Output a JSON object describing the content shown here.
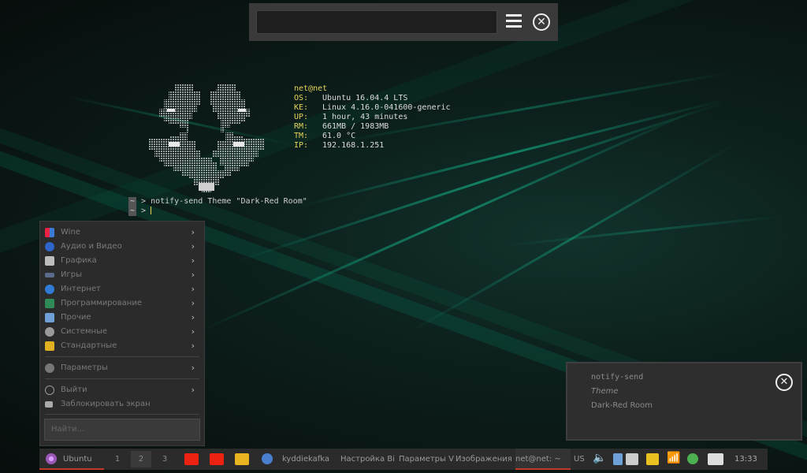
{
  "top_bar": {
    "search_value": "",
    "menu_icon": "hamburger-menu-icon",
    "close_icon": "close-circle-icon"
  },
  "neofetch": {
    "host": "net@net",
    "rows": [
      {
        "key": "OS:",
        "value": "Ubuntu 16.04.4 LTS"
      },
      {
        "key": "KE:",
        "value": "Linux 4.16.0-041600-generic"
      },
      {
        "key": "UP:",
        "value": "1 hour, 43 minutes"
      },
      {
        "key": "RM:",
        "value": "661MB / 1983MB"
      },
      {
        "key": "TM:",
        "value": "61.0 °C"
      },
      {
        "key": "IP:",
        "value": "192.168.1.251"
      }
    ]
  },
  "terminal": {
    "tag": "~",
    "prompt": ">",
    "command": "notify-send Theme \"Dark-Red Room\""
  },
  "app_menu": {
    "items": [
      {
        "label": "Wine",
        "icon": "wine-icon",
        "color": "#3b7bd6"
      },
      {
        "label": "Аудио и Видео",
        "icon": "audio-video-icon",
        "color": "#2f64c8"
      },
      {
        "label": "Графика",
        "icon": "graphics-icon",
        "color": "#bdbdbd"
      },
      {
        "label": "Игры",
        "icon": "games-icon",
        "color": "#5a6b8c"
      },
      {
        "label": "Интернет",
        "icon": "internet-icon",
        "color": "#2f7bd6"
      },
      {
        "label": "Программирование",
        "icon": "programming-icon",
        "color": "#2e8b57"
      },
      {
        "label": "Прочие",
        "icon": "other-icon",
        "color": "#6fa0d8"
      },
      {
        "label": "Системные",
        "icon": "system-icon",
        "color": "#9a9a9a"
      },
      {
        "label": "Стандартные",
        "icon": "accessories-icon",
        "color": "#e0b020"
      }
    ],
    "settings": {
      "label": "Параметры",
      "icon": "settings-icon"
    },
    "logout": {
      "label": "Выйти",
      "icon": "power-icon"
    },
    "lock": {
      "label": "Заблокировать экран",
      "icon": "lock-screen-icon"
    },
    "search_placeholder": "Найти..."
  },
  "notification": {
    "title": "notify-send",
    "summary": "Theme",
    "body": "Dark-Red Room"
  },
  "taskbar": {
    "start_label": "Ubuntu",
    "workspaces": [
      "1",
      "2",
      "3"
    ],
    "tasks": [
      "kyddiekafka",
      "Настройка Ві",
      "Параметры V",
      "Изображения",
      "net@net: ~"
    ],
    "keyboard_layout": "US",
    "clock": "13:33",
    "accent": "#c0392b"
  }
}
